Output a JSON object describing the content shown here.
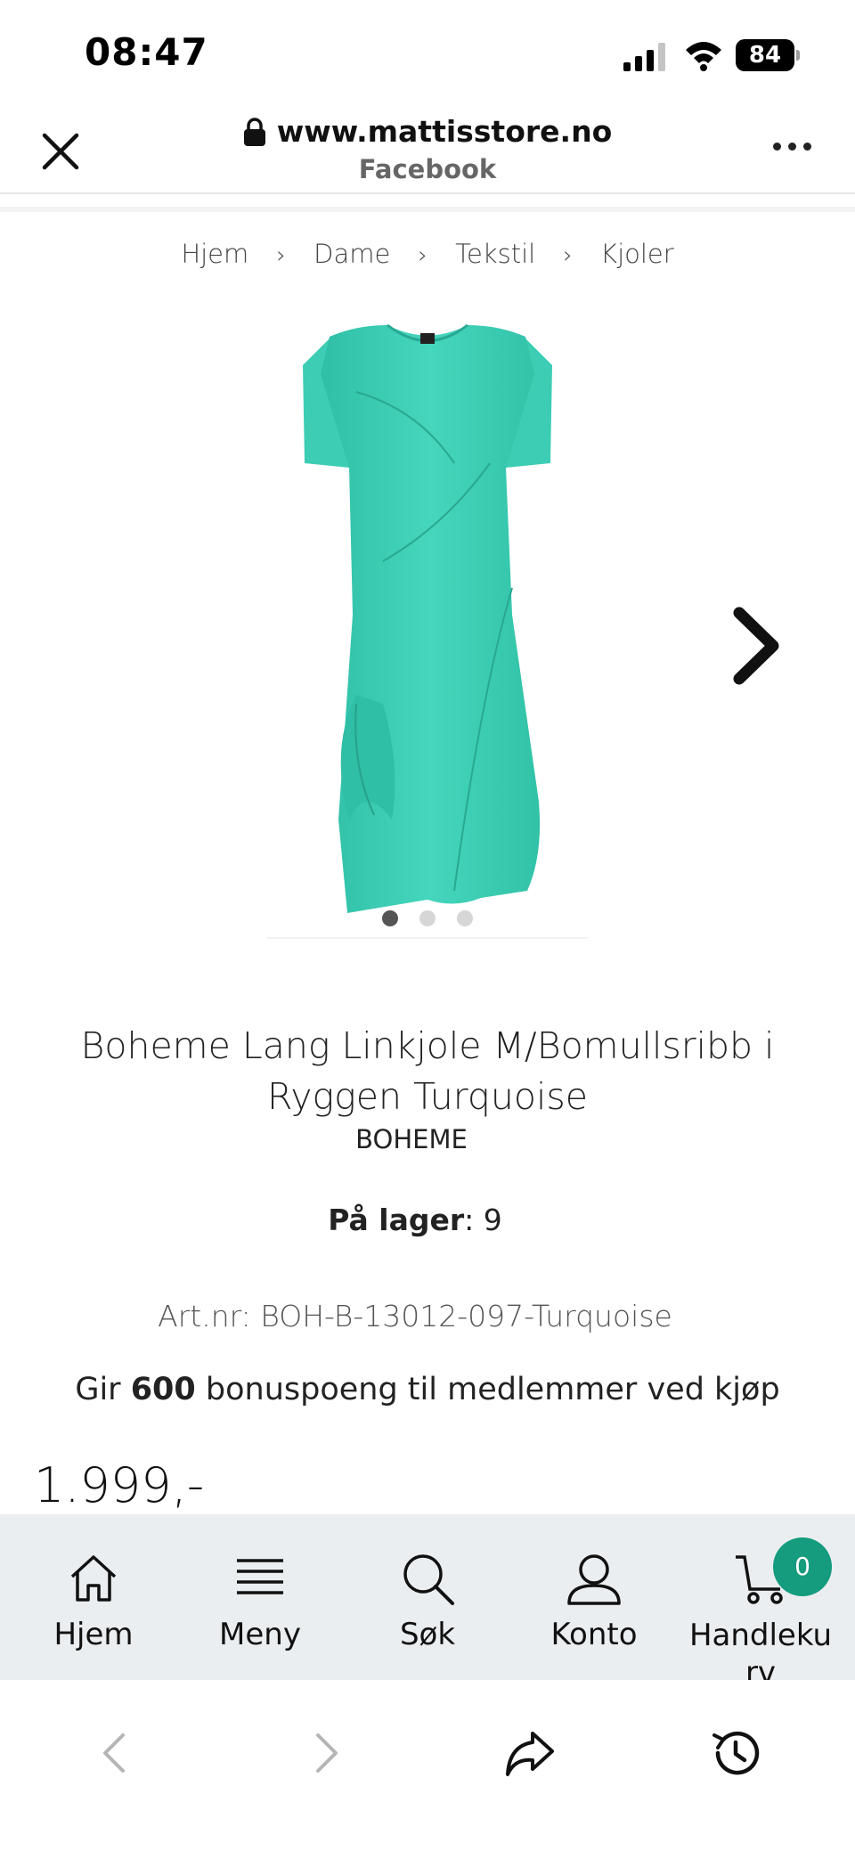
{
  "status": {
    "time": "08:47",
    "battery": "84"
  },
  "browser": {
    "url": "www.mattisstore.no",
    "source": "Facebook"
  },
  "breadcrumb": [
    "Hjem",
    "Dame",
    "Tekstil",
    "Kjoler"
  ],
  "product": {
    "title": "Boheme Lang Linkjole M/Bomullsribb i Ryggen Turquoise",
    "brand": "BOHEME",
    "stock_label": "På lager",
    "stock_value": ": 9",
    "art_nr": "Art.nr: BOH-B-13012-097-Turquoise",
    "bonus_prefix": "Gir ",
    "bonus_points": "600",
    "bonus_suffix": " bonuspoeng til medlemmer ved kjøp",
    "price": "1.999,-",
    "image_color": "#3fd1b8",
    "gallery_dots": 3,
    "gallery_active": 1
  },
  "bottom_nav": {
    "items": [
      {
        "label": "Hjem",
        "icon": "home-icon"
      },
      {
        "label": "Meny",
        "icon": "menu-icon"
      },
      {
        "label": "Søk",
        "icon": "search-icon"
      },
      {
        "label": "Konto",
        "icon": "user-icon"
      },
      {
        "label": "Handlekurv",
        "icon": "cart-icon"
      }
    ],
    "cart_count": "0",
    "badge_color": "#159b7e"
  }
}
